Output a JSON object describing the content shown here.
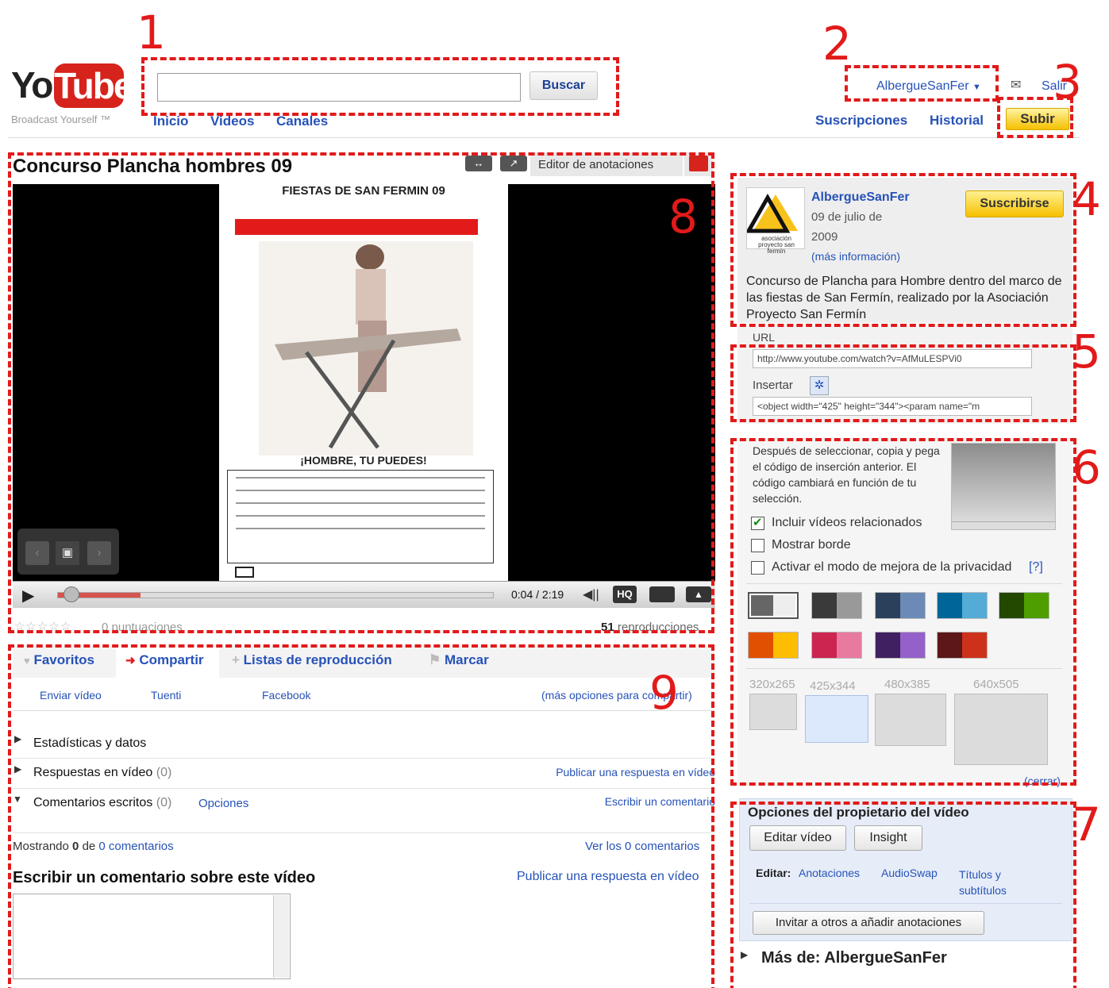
{
  "header": {
    "logo_you": "You",
    "logo_tube": "Tube",
    "logo_tagline": "Broadcast Yourself ™",
    "search_value": "",
    "search_button": "Buscar",
    "nav": [
      "Inicio",
      "Videos",
      "Canales"
    ],
    "username": "AlbergueSanFer",
    "mail_icon": "envelope-icon",
    "signout": "Salir",
    "subscriptions": "Suscripciones",
    "history": "Historial",
    "upload": "Subir"
  },
  "annotations": [
    "1",
    "2",
    "3",
    "4",
    "5",
    "6",
    "7",
    "8",
    "9"
  ],
  "video": {
    "title": "Concurso Plancha hombres 09",
    "annotation_editor": "Editor de anotaciones",
    "poster_heading": "FIESTAS DE SAN FERMIN 09",
    "poster_caption": "¡HOMBRE, TU PUEDES!",
    "time": "0:04 / 2:19",
    "progress": 0.19,
    "hq_label": "HQ",
    "ratings": "0 puntuaciones",
    "views_count": "51",
    "views_label": "reproducciones"
  },
  "actions": {
    "tabs": [
      "Favoritos",
      "Compartir",
      "Listas de reproducción",
      "Marcar"
    ],
    "share_links": [
      "Enviar vídeo",
      "Tuenti",
      "Facebook"
    ],
    "share_more": "(más opciones para compartir)",
    "stats": "Estadísticas y datos",
    "video_responses": "Respuestas en vídeo",
    "video_responses_count": "(0)",
    "post_video_response": "Publicar una respuesta en vídeo",
    "text_comments": "Comentarios escritos",
    "text_comments_count": "(0)",
    "options": "Opciones",
    "write_comment_link": "Escribir un comentario",
    "showing_prefix": "Mostrando",
    "showing_zero": "0",
    "showing_of": "de",
    "showing_total": "0 comentarios",
    "see_all": "Ver los 0 comentarios",
    "write_heading": "Escribir un comentario sobre este vídeo",
    "post_response_link": "Publicar una respuesta en vídeo"
  },
  "channel": {
    "name": "AlbergueSanFer",
    "date_line1": "09 de julio de",
    "date_line2": "2009",
    "more_info": "(más información)",
    "subscribe": "Suscribirse",
    "avatar_text": "asociación proyecto san fermín",
    "description": "Concurso de Plancha para Hombre dentro del marco de las fiestas de San Fermín, realizado por la Asociación Proyecto San Fermín"
  },
  "share": {
    "url_label": "URL",
    "url_value": "http://www.youtube.com/watch?v=AfMuLESPVi0",
    "embed_label": "Insertar",
    "embed_value": "<object width=\"425\" height=\"344\"><param name=\"m"
  },
  "embed_options": {
    "help": "Después de seleccionar, copia y pega el código de inserción anterior. El código cambiará en función de tu selección.",
    "related": "Incluir vídeos relacionados",
    "related_checked": true,
    "border": "Mostrar borde",
    "privacy": "Activar el modo de mejora de la privacidad",
    "privacy_help": "[?]",
    "colors": [
      [
        "#666666",
        "#eeeeee"
      ],
      [
        "#3a3a3a",
        "#999999"
      ],
      [
        "#2b405b",
        "#6b8ab6"
      ],
      [
        "#006699",
        "#54abd6"
      ],
      [
        "#234900",
        "#4e9e00"
      ],
      [
        "#e14f00",
        "#febd01"
      ],
      [
        "#cc2550",
        "#e87a9f"
      ],
      [
        "#402061",
        "#9461ca"
      ],
      [
        "#5d1719",
        "#cd311b"
      ]
    ],
    "sizes": [
      "320x265",
      "425x344",
      "480x385",
      "640x505"
    ],
    "selected_size": "425x344",
    "close": "(cerrar)"
  },
  "owner": {
    "title": "Opciones del propietario del vídeo",
    "edit_video": "Editar vídeo",
    "insight": "Insight",
    "edit_label": "Editar:",
    "edit_links": [
      "Anotaciones",
      "AudioSwap",
      "Títulos y subtítulos"
    ],
    "invite": "Invitar a otros a añadir anotaciones"
  },
  "more_from": "Más de: AlbergueSanFer"
}
